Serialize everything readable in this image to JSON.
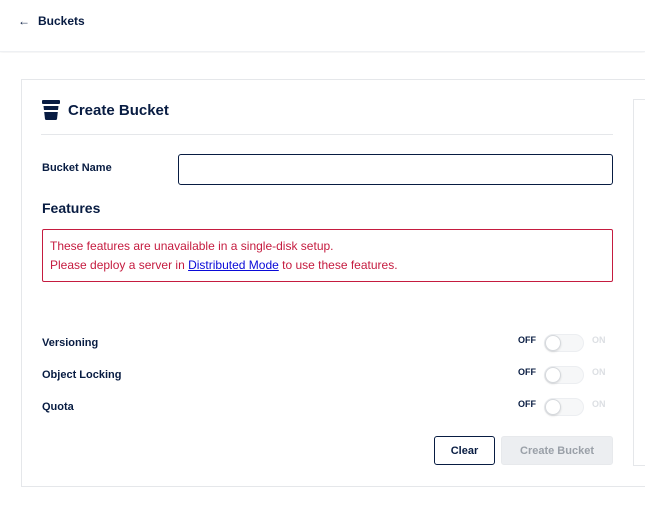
{
  "nav": {
    "back_label": "Buckets"
  },
  "form": {
    "title": "Create Bucket",
    "bucket_name_label": "Bucket Name",
    "bucket_name_value": "",
    "features_title": "Features",
    "alert_line1": "These features are unavailable in a single-disk setup.",
    "alert_line2_prefix": "Please deploy a server in ",
    "alert_link": "Distributed Mode",
    "alert_line2_suffix": " to use these features.",
    "options": [
      {
        "label": "Versioning",
        "off": "OFF",
        "on": "ON",
        "enabled": false
      },
      {
        "label": "Object Locking",
        "off": "OFF",
        "on": "ON",
        "enabled": false
      },
      {
        "label": "Quota",
        "off": "OFF",
        "on": "ON",
        "enabled": false
      }
    ],
    "clear_label": "Clear",
    "create_label": "Create Bucket"
  },
  "icons": {
    "back": "arrow-left-icon",
    "bucket": "bucket-icon"
  },
  "colors": {
    "primary": "#081c42",
    "alert": "#c51b3f",
    "link": "#0a0ad8",
    "disabled": "#eceef1"
  }
}
